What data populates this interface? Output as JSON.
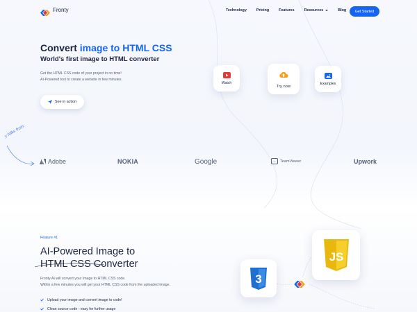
{
  "header": {
    "logo_text": "Fronty",
    "nav": [
      {
        "label": "Technology"
      },
      {
        "label": "Pricing"
      },
      {
        "label": "Features"
      },
      {
        "label": "Resources",
        "dropdown": true
      },
      {
        "label": "Blog"
      }
    ],
    "cta_label": "Get Started"
  },
  "hero": {
    "title_prefix": "Convert ",
    "title_accent": "image to HTML CSS",
    "subtitle": "World's first image to HTML converter",
    "desc_line1": "Get the HTML CSS code of your project in no time!",
    "desc_line2": "AI-Powered tool to create a website in few minutes.",
    "see_button": "See in action",
    "cards": [
      {
        "label": "Watch",
        "icon": "youtube-icon"
      },
      {
        "label": "Try now",
        "icon": "cloud-upload-icon"
      },
      {
        "label": "Examples",
        "icon": "image-icon"
      }
    ]
  },
  "trusted": {
    "label": "y folks from:",
    "brands": [
      "Adobe",
      "NOKIA",
      "Google",
      "TeamViewer",
      "Upwork"
    ]
  },
  "feature": {
    "tag": "Feature #1",
    "title_line1": "AI-Powered Image to",
    "title_line2": "HTML CSS Converter",
    "desc_line1": "Fronty AI will convert your Image to HTML CSS code.",
    "desc_line2": "Within a few minutes you will get your HTML CSS code from the uploaded image.",
    "checks": [
      "Upload your image and convert image to code!",
      "Clean source code - easy for further usage"
    ],
    "css_badge": "3",
    "js_badge": "JS"
  },
  "colors": {
    "accent": "#1565f0",
    "text": "#1b2340",
    "muted": "#5b6276",
    "youtube": "#e53935",
    "upload": "#f6a21e",
    "css": "#1e6fd0",
    "js": "#f0c419"
  }
}
